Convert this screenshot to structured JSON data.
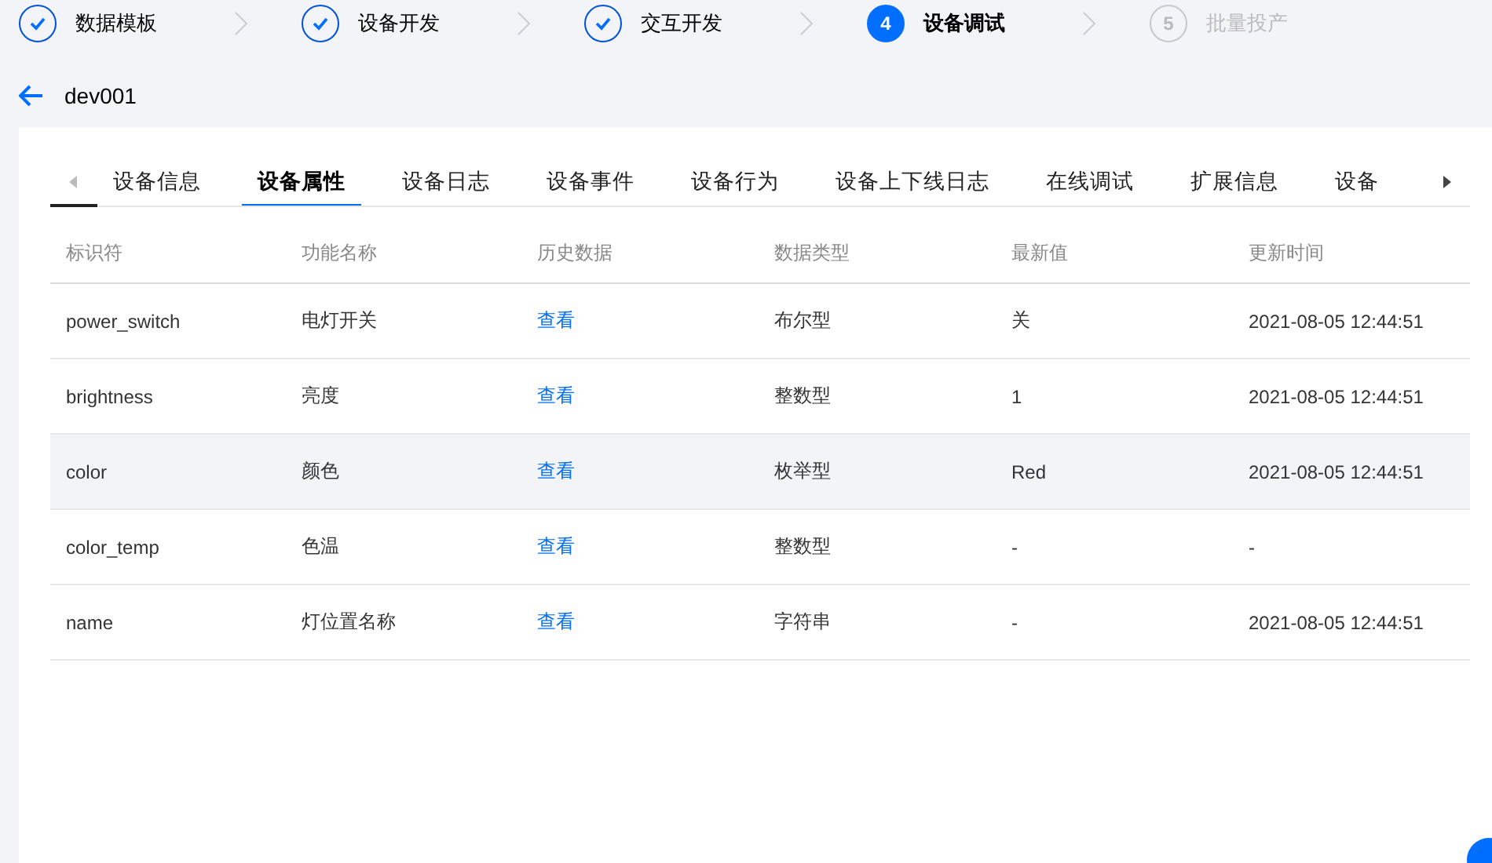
{
  "steps": [
    {
      "label": "数据模板",
      "kind": "done"
    },
    {
      "label": "设备开发",
      "kind": "done"
    },
    {
      "label": "交互开发",
      "kind": "done"
    },
    {
      "number": "4",
      "label": "设备调试",
      "kind": "current"
    },
    {
      "number": "5",
      "label": "批量投产",
      "kind": "pending"
    }
  ],
  "device": {
    "name": "dev001"
  },
  "tabs": [
    {
      "label": "设备信息",
      "selected": false
    },
    {
      "label": "设备属性",
      "selected": true
    },
    {
      "label": "设备日志",
      "selected": false
    },
    {
      "label": "设备事件",
      "selected": false
    },
    {
      "label": "设备行为",
      "selected": false
    },
    {
      "label": "设备上下线日志",
      "selected": false
    },
    {
      "label": "在线调试",
      "selected": false
    },
    {
      "label": "扩展信息",
      "selected": false
    },
    {
      "label": "设备",
      "selected": false
    }
  ],
  "table": {
    "columns": [
      "标识符",
      "功能名称",
      "历史数据",
      "数据类型",
      "最新值",
      "更新时间"
    ],
    "rows": [
      {
        "cells": [
          "power_switch",
          "电灯开关",
          "查看",
          "布尔型",
          "关",
          "2021-08-05 12:44:51"
        ],
        "selected": false
      },
      {
        "cells": [
          "brightness",
          "亮度",
          "查看",
          "整数型",
          "1",
          "2021-08-05 12:44:51"
        ],
        "selected": false
      },
      {
        "cells": [
          "color",
          "颜色",
          "查看",
          "枚举型",
          "Red",
          "2021-08-05 12:44:51"
        ],
        "selected": true
      },
      {
        "cells": [
          "color_temp",
          "色温",
          "查看",
          "整数型",
          "-",
          "-"
        ],
        "selected": false
      },
      {
        "cells": [
          "name",
          "灯位置名称",
          "查看",
          "字符串",
          "-",
          "2021-08-05 12:44:51"
        ],
        "selected": false
      }
    ]
  }
}
